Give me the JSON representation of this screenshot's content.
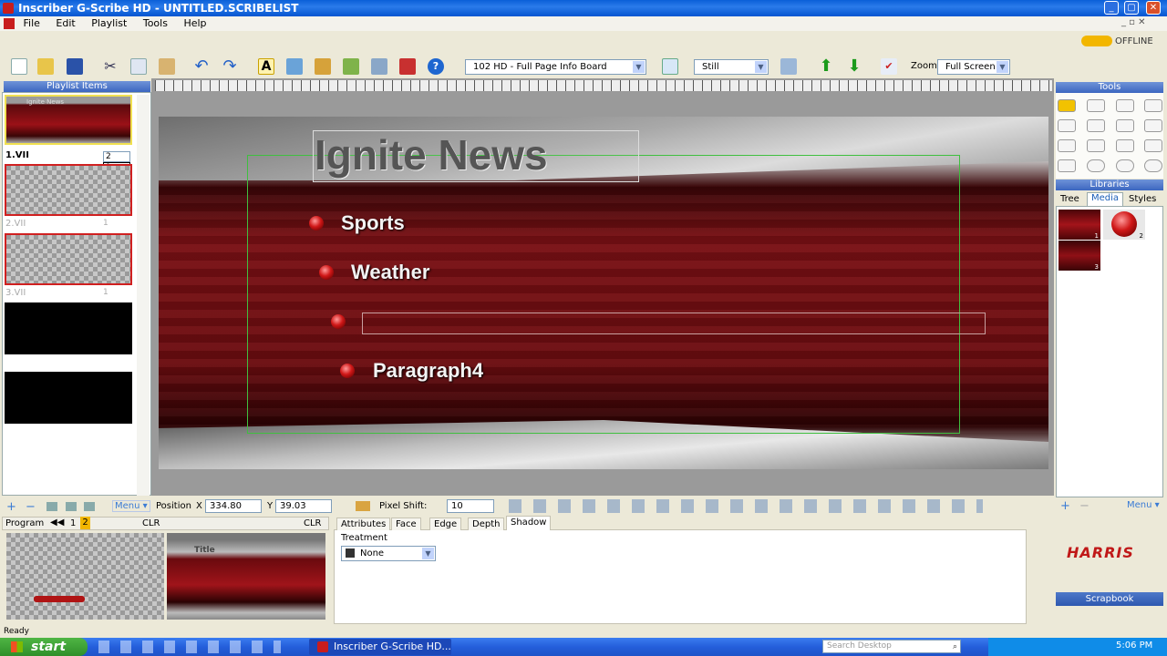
{
  "window": {
    "title": "Inscriber G-Scribe HD - UNTITLED.SCRIBELIST"
  },
  "menu": [
    "File",
    "Edit",
    "Playlist",
    "Tools",
    "Help"
  ],
  "status_offline": "OFFLINE",
  "toolbar": {
    "template_select": "102 HD - Full Page Info Board",
    "mode_select": "Still",
    "zoom_label": "Zoom",
    "zoom_select": "Full Screen"
  },
  "playlist": {
    "header": "Playlist Items",
    "items": [
      {
        "name": "1.VII",
        "count": "2",
        "thumb_title": "Ignite News"
      },
      {
        "name": "2.VII",
        "count": "1"
      },
      {
        "name": "3.VII",
        "count": "1"
      }
    ],
    "dropdown_options": [
      "1",
      "2"
    ],
    "menu_label": "Menu"
  },
  "canvas": {
    "title": "Ignite News",
    "paragraphs": [
      "Sports",
      "Weather",
      "",
      "Paragraph4"
    ]
  },
  "position": {
    "label": "Position",
    "x_label": "X",
    "x": "334.80",
    "y_label": "Y",
    "y": "39.03"
  },
  "pixel_shift": {
    "label": "Pixel Shift:",
    "value": "10"
  },
  "program": {
    "label": "Program",
    "num1": "1",
    "num2": "2",
    "clr1": "CLR",
    "clr2": "CLR",
    "preview_title": "Title"
  },
  "attr_tabs": [
    "Attributes",
    "Face",
    "Edge",
    "Depth",
    "Shadow"
  ],
  "attr_panel": {
    "treatment_label": "Treatment",
    "treatment_value": "None"
  },
  "tools": {
    "header": "Tools"
  },
  "libraries": {
    "header": "Libraries",
    "tabs": [
      "Tree",
      "Media",
      "Styles"
    ],
    "badges": [
      "1",
      "2",
      "3"
    ],
    "menu_label": "Menu"
  },
  "scrapbook": {
    "brand": "HARRIS",
    "label": "Scrapbook"
  },
  "statusbar": {
    "text": "Ready"
  },
  "taskbar": {
    "start": "start",
    "task": "Inscriber G-Scribe HD...",
    "search_placeholder": "Search Desktop",
    "clock": "5:06 PM"
  }
}
